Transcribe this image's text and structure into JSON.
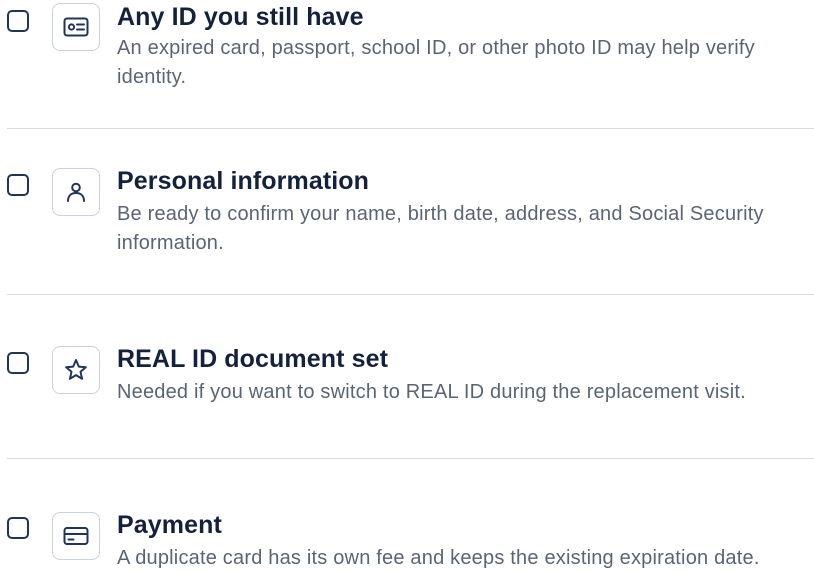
{
  "items": [
    {
      "icon": "id-card-icon",
      "title": "Any ID you still have",
      "description": "An expired card, passport, school ID, or other photo ID may help verify identity."
    },
    {
      "icon": "user-icon",
      "title": "Personal information",
      "description": "Be ready to confirm your name, birth date, address, and Social Security information."
    },
    {
      "icon": "star-icon",
      "title": "REAL ID document set",
      "description": "Needed if you want to switch to REAL ID during the replacement visit."
    },
    {
      "icon": "credit-card-icon",
      "title": "Payment",
      "description": "A duplicate card has its own fee and keeps the existing expiration date."
    }
  ],
  "colors": {
    "title": "#14213d",
    "description": "#5b6475",
    "checkbox_border": "#22335c",
    "icon_stroke": "#22335c",
    "icon_box_border": "#c9d0e0",
    "divider": "#d6dbe6"
  }
}
